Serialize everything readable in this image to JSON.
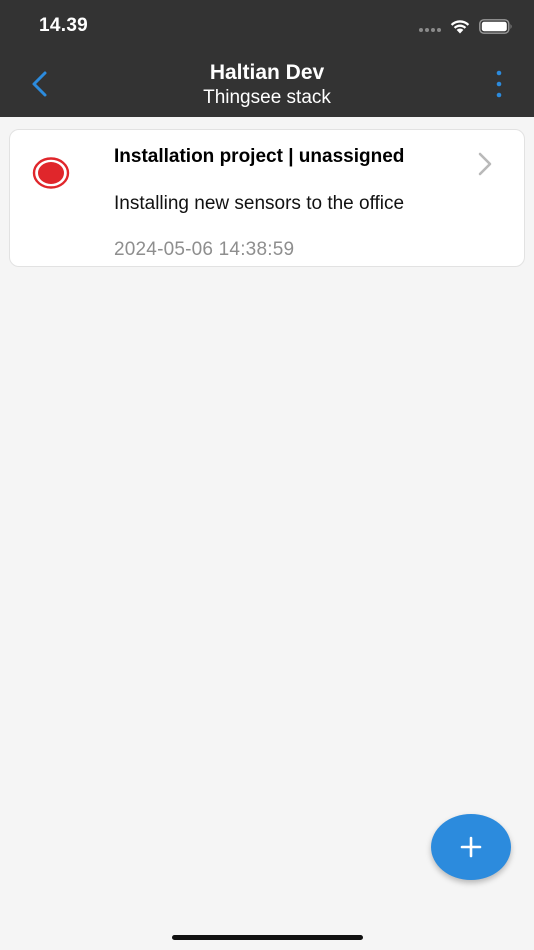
{
  "status_bar": {
    "time": "14.39"
  },
  "header": {
    "title": "Haltian Dev",
    "subtitle": "Thingsee stack",
    "back_icon": "chevron-left-icon",
    "menu_icon": "more-vertical-icon"
  },
  "list": {
    "items": [
      {
        "title": "Installation project | unassigned",
        "description": "Installing new sensors to the office",
        "timestamp": "2024-05-06 14:38:59",
        "status_icon": "record-status-icon",
        "status_color": "#e0262b"
      }
    ]
  },
  "fab": {
    "icon": "plus-icon"
  },
  "colors": {
    "header_bg": "#333333",
    "accent": "#2c8bdd",
    "page_bg": "#f5f5f5"
  }
}
